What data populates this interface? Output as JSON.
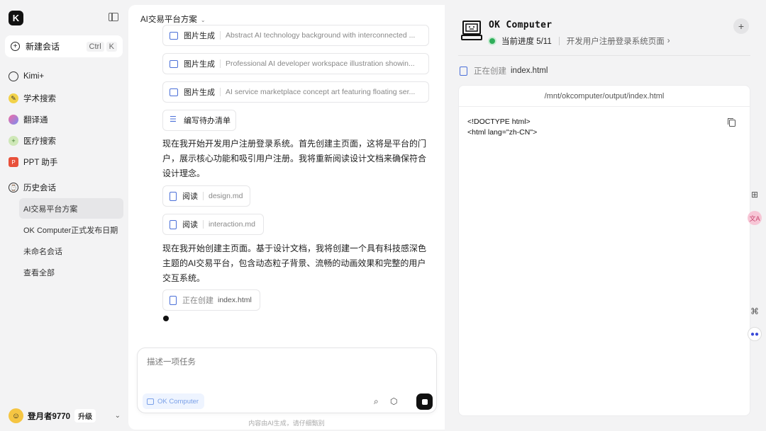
{
  "sidebar": {
    "logo": "K",
    "new_chat": {
      "label": "新建会话",
      "kbd1": "Ctrl",
      "kbd2": "K"
    },
    "nav": [
      {
        "label": "Kimi+",
        "icon": "kimi-plus-icon"
      },
      {
        "label": "学术搜索",
        "icon": "academic-search-icon"
      },
      {
        "label": "翻译通",
        "icon": "translate-icon"
      },
      {
        "label": "医疗搜索",
        "icon": "medical-search-icon"
      },
      {
        "label": "PPT 助手",
        "icon": "ppt-icon"
      }
    ],
    "history_label": "历史会话",
    "history": [
      {
        "label": "AI交易平台方案",
        "active": true
      },
      {
        "label": "OK Computer正式发布日期"
      },
      {
        "label": "未命名会话"
      },
      {
        "label": "查看全部"
      }
    ],
    "user": {
      "name": "登月者9770",
      "upgrade": "升级"
    }
  },
  "chat": {
    "title": "AI交易平台方案",
    "chips": [
      {
        "verb": "图片生成",
        "detail": "Abstract AI technology background with interconnected ..."
      },
      {
        "verb": "图片生成",
        "detail": "Professional AI developer workspace illustration showin..."
      },
      {
        "verb": "图片生成",
        "detail": "AI service marketplace concept art featuring floating ser..."
      },
      {
        "verb": "编写待办清单",
        "detail": ""
      }
    ],
    "message1": "现在我开始开发用户注册登录系统。首先创建主页面，这将是平台的门户，展示核心功能和吸引用户注册。我将重新阅读设计文档来确保符合设计理念。",
    "read_chips": [
      {
        "verb": "阅读",
        "detail": "design.md"
      },
      {
        "verb": "阅读",
        "detail": "interaction.md"
      }
    ],
    "message2": "现在我开始创建主页面。基于设计文档，我将创建一个具有科技感深色主题的AI交易平台，包含动态粒子背景、流畅的动画效果和完整的用户交互系统。",
    "creating_chip": {
      "verb": "正在创建",
      "detail": "index.html"
    },
    "composer": {
      "placeholder": "描述一项任务",
      "mode": "OK Computer"
    },
    "disclaimer": "内容由AI生成，请仔细甄别"
  },
  "panel": {
    "title": "OK Computer",
    "progress_label": "当前进度 5/11",
    "step": "开发用户注册登录系统页面",
    "creating_verb": "正在创建",
    "creating_file": "index.html",
    "code_path": "/mnt/okcomputer/output/index.html",
    "code_lines": [
      "<!DOCTYPE html>",
      "<html lang=\"zh-CN\">"
    ]
  },
  "colors": {
    "accent": "#4a6fd8",
    "progress_green": "#2fae5a",
    "send_bg": "#111111"
  }
}
